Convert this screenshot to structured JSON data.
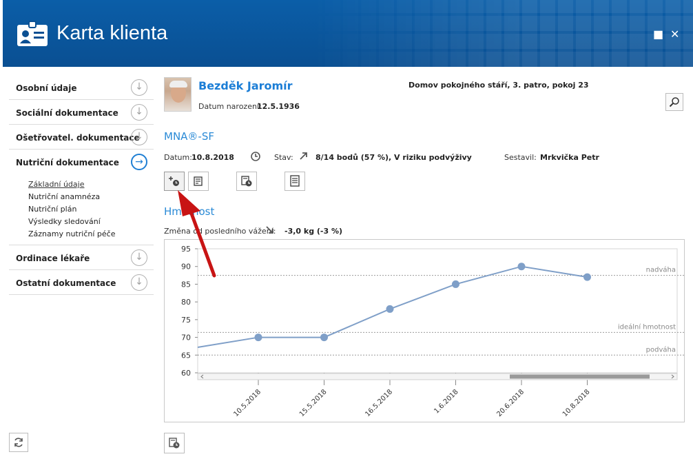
{
  "window": {
    "title": "Karta klienta",
    "maximize_glyph": "■",
    "close_glyph": "✕"
  },
  "sidebar": {
    "sections": [
      {
        "label": "Osobní údaje",
        "icon": "arrow-down-circle-icon",
        "active": false
      },
      {
        "label": "Sociální dokumentace",
        "icon": "arrow-down-circle-icon",
        "active": false
      },
      {
        "label": "Ošetřovatel. dokumentace",
        "icon": "arrow-down-circle-icon",
        "active": false
      },
      {
        "label": "Nutriční dokumentace",
        "icon": "arrow-right-circle-icon",
        "active": true
      },
      {
        "label": "Ordinace lékaře",
        "icon": "arrow-down-circle-icon",
        "active": false
      },
      {
        "label": "Ostatní dokumentace",
        "icon": "arrow-down-circle-icon",
        "active": false
      }
    ],
    "nutri_items": [
      "Základní údaje",
      "Nutriční anamnéza",
      "Nutriční plán",
      "Výsledky sledování",
      "Záznamy nutriční péče"
    ],
    "selected_item": "Základní údaje"
  },
  "patient": {
    "name": "Bezděk Jaromír",
    "dob_label": "Datum narození:",
    "dob": "12.5.1936",
    "location": "Domov pokojného stáří, 3. patro, pokoj 23"
  },
  "mna": {
    "title": "MNA®-SF",
    "date_label": "Datum:",
    "date": "10.8.2018",
    "status_label": "Stav:",
    "status": "8/14 bodů (57 %), V riziku podvýživy",
    "author_label": "Sestavil:",
    "author": "Mrkvička Petr"
  },
  "weight": {
    "title": "Hmotnost",
    "change_label": "Změna od posledního vážení:",
    "change_value": "-3,0 kg (-3 %)"
  },
  "colors": {
    "header_bg": "#0a4f92",
    "accent": "#1c7ed6",
    "series": "#7f9fc8",
    "annotation_arrow": "#c81414"
  },
  "chart_data": {
    "type": "line",
    "categories": [
      "10.5.2018",
      "15.5.2018",
      "16.5.2018",
      "1.6.2018",
      "20.6.2018",
      "10.8.2018"
    ],
    "series": [
      {
        "values": [
          70,
          70,
          78,
          85,
          90,
          87
        ]
      }
    ],
    "ylim": [
      60,
      95
    ],
    "yticks": [
      60,
      65,
      70,
      75,
      80,
      85,
      90,
      95
    ],
    "reference_lines": [
      {
        "label": "nadváha",
        "value": 87.5
      },
      {
        "label": "ideální hmotnost",
        "value": 71.4
      },
      {
        "label": "podváha",
        "value": 65
      }
    ],
    "grid": false,
    "legend": "none"
  }
}
